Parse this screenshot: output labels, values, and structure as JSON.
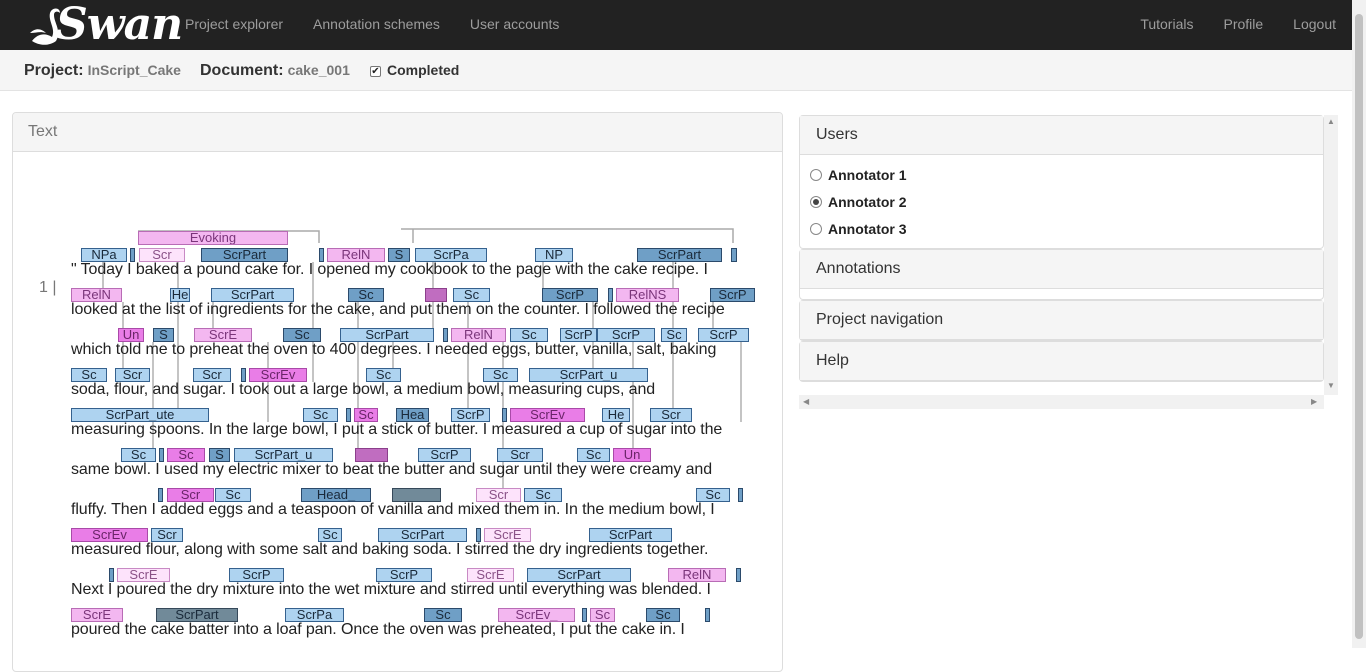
{
  "brand": {
    "name": "Swan"
  },
  "nav": {
    "left": [
      "Project explorer",
      "Annotation schemes",
      "User accounts"
    ],
    "right": [
      "Tutorials",
      "Profile",
      "Logout"
    ]
  },
  "subheader": {
    "project_label": "Project:",
    "project_value": "InScript_Cake",
    "document_label": "Document:",
    "document_value": "cake_001",
    "completed_label": "Completed",
    "completed_checked": true
  },
  "text_panel": {
    "heading": "Text",
    "line_number": "1 |",
    "lines": [
      "\" Today I baked a pound cake for. I opened my cookbook to the page with the cake recipe. I",
      "looked at the list of ingredients for the cake, and put them on the counter. I followed the recipe",
      "which told me to preheat the oven to 400 degrees. I needed eggs, butter, vanilla, salt, baking",
      "soda, flour, and sugar. I took out a large bowl, a medium bowl, measuring cups, and",
      "measuring spoons. In the large bowl, I put a stick of butter. I measured a cup of sugar into the",
      "same bowl. I used my electric mixer to beat the butter and sugar until they were creamy and",
      "fluffy. Then I added eggs and a teaspoon of vanilla and mixed them in. In the medium bowl, I",
      "measured flour, along with some salt and baking soda. I stirred the dry ingredients together.",
      "Next I poured the dry mixture into the wet mixture and stirred until everything was blended. I",
      "poured the cake batter into a loaf pan. Once the oven was preheated, I put the cake in. I"
    ],
    "annotations": [
      [
        {
          "label": "Evoking",
          "c": "pinklight"
        },
        {
          "label": "NPa",
          "c": "light"
        },
        {
          "label": "",
          "c": "mid"
        },
        {
          "label": "Scr",
          "c": "pinkpale"
        },
        {
          "label": "ScrPart",
          "c": "mid"
        },
        {
          "label": "",
          "c": "mid"
        },
        {
          "label": "RelN",
          "c": "pinklight"
        },
        {
          "label": "S",
          "c": "mid"
        },
        {
          "label": "ScrPa",
          "c": "light"
        },
        {
          "label": "NP",
          "c": "light"
        },
        {
          "label": "ScrPart",
          "c": "mid"
        },
        {
          "label": "",
          "c": "mid"
        }
      ],
      [
        {
          "label": "RelN",
          "c": "pinklight"
        },
        {
          "label": "He",
          "c": "light"
        },
        {
          "label": "ScrPart",
          "c": "light"
        },
        {
          "label": "Sc",
          "c": "mid"
        },
        {
          "label": "",
          "c": "purple"
        },
        {
          "label": "Sc",
          "c": "light"
        },
        {
          "label": "ScrP",
          "c": "mid"
        },
        {
          "label": "",
          "c": "mid"
        },
        {
          "label": "RelNS",
          "c": "pinklight"
        },
        {
          "label": "ScrP",
          "c": "mid"
        }
      ],
      [
        {
          "label": "Un",
          "c": "pink"
        },
        {
          "label": "S",
          "c": "mid"
        },
        {
          "label": "ScrE",
          "c": "pinklight"
        },
        {
          "label": "Sc",
          "c": "mid"
        },
        {
          "label": "ScrPart",
          "c": "light"
        },
        {
          "label": "",
          "c": "mid"
        },
        {
          "label": "RelN",
          "c": "pinklight"
        },
        {
          "label": "Sc",
          "c": "light"
        },
        {
          "label": "ScrP",
          "c": "light"
        },
        {
          "label": "ScrP",
          "c": "light"
        },
        {
          "label": "Sc",
          "c": "light"
        },
        {
          "label": "ScrP",
          "c": "light"
        }
      ],
      [
        {
          "label": "Sc",
          "c": "light"
        },
        {
          "label": "Scr",
          "c": "light"
        },
        {
          "label": "Scr",
          "c": "light"
        },
        {
          "label": "",
          "c": "mid"
        },
        {
          "label": "ScrEv",
          "c": "pink"
        },
        {
          "label": "Sc",
          "c": "light"
        },
        {
          "label": "Sc",
          "c": "light"
        },
        {
          "label": "ScrPart_u",
          "c": "light"
        }
      ],
      [
        {
          "label": "ScrPart_ute",
          "c": "light"
        },
        {
          "label": "Sc",
          "c": "light"
        },
        {
          "label": "",
          "c": "mid"
        },
        {
          "label": "Sc",
          "c": "pink"
        },
        {
          "label": "Hea",
          "c": "mid"
        },
        {
          "label": "ScrP",
          "c": "light"
        },
        {
          "label": "",
          "c": "mid"
        },
        {
          "label": "ScrEv",
          "c": "pink"
        },
        {
          "label": "He",
          "c": "light"
        },
        {
          "label": "Scr",
          "c": "light"
        }
      ],
      [
        {
          "label": "Sc",
          "c": "light"
        },
        {
          "label": "",
          "c": "mid"
        },
        {
          "label": "Sc",
          "c": "pink"
        },
        {
          "label": "S",
          "c": "mid"
        },
        {
          "label": "ScrPart_u",
          "c": "light"
        },
        {
          "label": "",
          "c": "purple"
        },
        {
          "label": "ScrP",
          "c": "light"
        },
        {
          "label": "Scr",
          "c": "light"
        },
        {
          "label": "Sc",
          "c": "light"
        },
        {
          "label": "Un",
          "c": "pink"
        }
      ],
      [
        {
          "label": "",
          "c": "mid"
        },
        {
          "label": "Scr",
          "c": "pink"
        },
        {
          "label": "Sc",
          "c": "light"
        },
        {
          "label": "Head_",
          "c": "mid"
        },
        {
          "label": "",
          "c": "dark"
        },
        {
          "label": "Scr",
          "c": "pinkpale"
        },
        {
          "label": "Sc",
          "c": "light"
        },
        {
          "label": "Sc",
          "c": "light"
        },
        {
          "label": "",
          "c": "mid"
        }
      ],
      [
        {
          "label": "ScrEv",
          "c": "pink"
        },
        {
          "label": "Scr",
          "c": "light"
        },
        {
          "label": "Sc",
          "c": "light"
        },
        {
          "label": "ScrPart",
          "c": "light"
        },
        {
          "label": "",
          "c": "mid"
        },
        {
          "label": "ScrE",
          "c": "pinkpale"
        },
        {
          "label": "ScrPart",
          "c": "light"
        }
      ],
      [
        {
          "label": "",
          "c": "mid"
        },
        {
          "label": "ScrE",
          "c": "pinkpale"
        },
        {
          "label": "ScrP",
          "c": "light"
        },
        {
          "label": "ScrP",
          "c": "light"
        },
        {
          "label": "ScrE",
          "c": "pinkpale"
        },
        {
          "label": "ScrPart",
          "c": "light"
        },
        {
          "label": "RelN",
          "c": "pinklight"
        },
        {
          "label": "",
          "c": "mid"
        }
      ],
      [
        {
          "label": "ScrE",
          "c": "pinklight"
        },
        {
          "label": "ScrPart",
          "c": "dark"
        },
        {
          "label": "ScrPa",
          "c": "light"
        },
        {
          "label": "Sc",
          "c": "mid"
        },
        {
          "label": "ScrEv_",
          "c": "pinklight"
        },
        {
          "label": "",
          "c": "mid"
        },
        {
          "label": "Sc",
          "c": "pinklight"
        },
        {
          "label": "Sc",
          "c": "mid"
        },
        {
          "label": "",
          "c": "mid"
        }
      ]
    ]
  },
  "right": {
    "users_heading": "Users",
    "users": [
      {
        "name": "Annotator 1",
        "selected": false
      },
      {
        "name": "Annotator 2",
        "selected": true
      },
      {
        "name": "Annotator 3",
        "selected": false
      }
    ],
    "annotations_heading": "Annotations",
    "navigation_heading": "Project navigation",
    "help_heading": "Help"
  },
  "colors": {
    "navbar": "#222222",
    "annotation_light": "#aed3f0",
    "annotation_mid": "#6f9fc6",
    "annotation_dark": "#718a99",
    "annotation_pink": "#e97de7",
    "annotation_pinklight": "#f3b7f0",
    "annotation_pinkpale": "#fde3fb"
  }
}
